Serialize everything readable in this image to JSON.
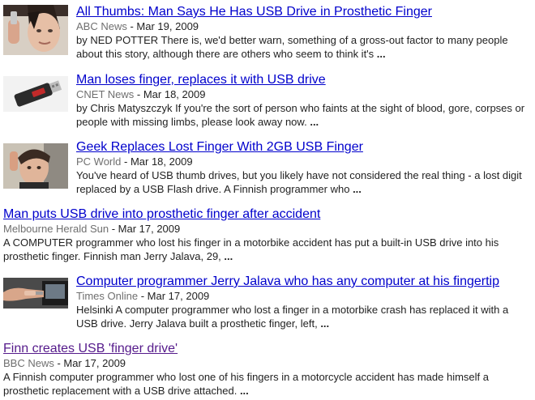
{
  "results": [
    {
      "title": "All Thumbs: Man Says He Has USB Drive in Prosthetic Finger",
      "source": "ABC News",
      "date": "Mar 19, 2009",
      "snippet": "by NED POTTER There is, we'd better warn, something of a gross-out factor to many people about this story, although there are others who seem to think it's",
      "ellipsis": "...",
      "thumbnail": "man-holding-finger-photo"
    },
    {
      "title": "Man loses finger, replaces it with USB drive",
      "source": "CNET News",
      "date": "Mar 18, 2009",
      "snippet": "by Chris Matyszczyk If you're the sort of person who faints at the sight of blood, gore, corpses or people with missing limbs, please look away now.",
      "ellipsis": "...",
      "thumbnail": "usb-drive-photo"
    },
    {
      "title": "Geek Replaces Lost Finger With 2GB USB Finger",
      "source": "PC World",
      "date": "Mar 18, 2009",
      "snippet": "You've heard of USB thumb drives, but you likely have not considered the real thing - a lost digit replaced by a USB Flash drive. A Finnish programmer who",
      "ellipsis": "...",
      "thumbnail": "man-portrait-photo"
    },
    {
      "title": "Man puts USB drive into prosthetic finger after accident",
      "source": "Melbourne Herald Sun",
      "date": "Mar 17, 2009",
      "snippet": "A COMPUTER programmer who lost his finger in a motorbike accident has put a built-in USB drive into his prosthetic finger. Finnish man Jerry Jalava, 29,",
      "ellipsis": "..."
    },
    {
      "title": "Computer programmer Jerry Jalava who has any computer at his fingertip",
      "source": "Times Online",
      "date": "Mar 17, 2009",
      "snippet": "Helsinki A computer programmer who lost a finger in a motorbike crash has replaced it with a USB drive. Jerry Jalava built a prosthetic finger, left,",
      "ellipsis": "...",
      "thumbnail": "hand-with-laptop-photo"
    },
    {
      "title": "Finn creates USB 'finger drive'",
      "source": "BBC News",
      "date": "Mar 17, 2009",
      "snippet": "A Finnish computer programmer who lost one of his fingers in a motorcycle accident has made himself a prosthetic replacement with a USB drive attached.",
      "ellipsis": "...",
      "visited": true
    }
  ],
  "date_separator": " - ",
  "colors": {
    "link": "#0000cc",
    "visited_link": "#551a8b",
    "source": "#6f6f6f",
    "text": "#222222"
  }
}
